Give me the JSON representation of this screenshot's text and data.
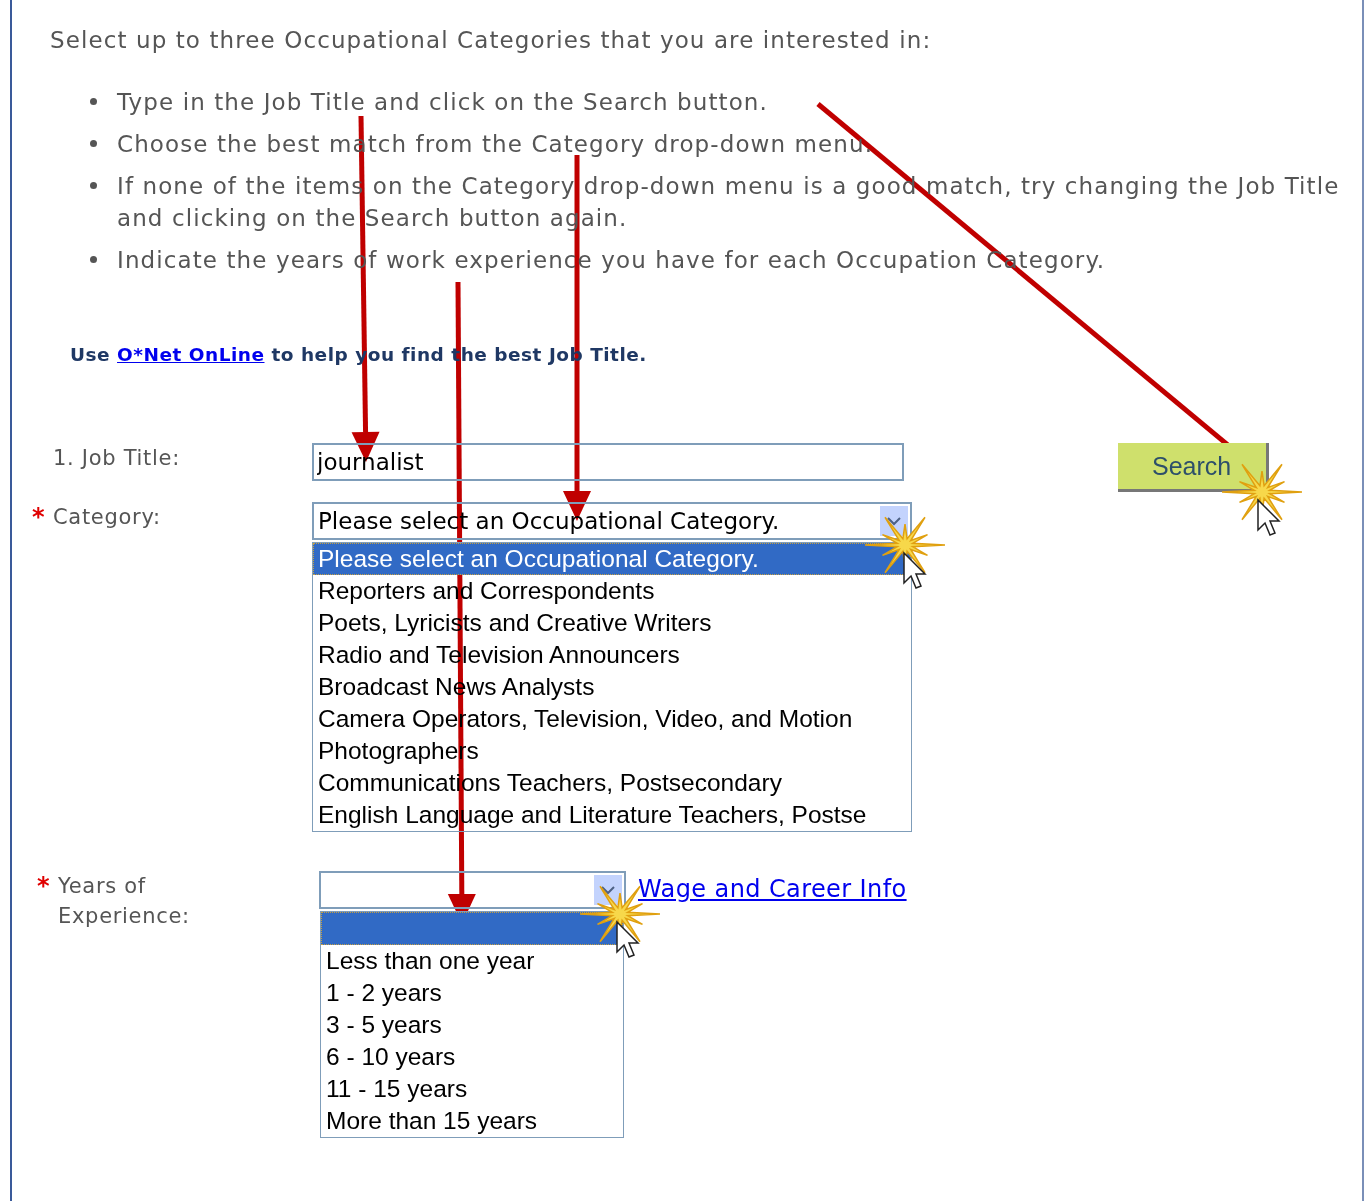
{
  "instructions": {
    "intro": "Select up to three Occupational Categories that you are interested in:",
    "bullets": [
      "Type in the Job Title and click on the Search button.",
      "Choose the best match from the Category drop-down menu.",
      "If none of the items on the Category drop-down menu is a good match, try changing the Job Title and clicking on the Search button again.",
      "Indicate the years of work experience you have for each Occupation Category."
    ]
  },
  "help_note": {
    "before": "Use ",
    "link": "O*Net OnLine",
    "after": " to help you find the best Job Title."
  },
  "form": {
    "job_title": {
      "label": "1. Job Title:",
      "value": "journalist"
    },
    "search_button": "Search",
    "category": {
      "required_mark": "*",
      "label": "Category:",
      "value": "Please select an Occupational Category.",
      "expanded": true,
      "options": [
        {
          "label": "Please select an Occupational Category.",
          "selected": true
        },
        {
          "label": "Reporters and Correspondents",
          "selected": false
        },
        {
          "label": "Poets, Lyricists and Creative Writers",
          "selected": false
        },
        {
          "label": "Radio and Television Announcers",
          "selected": false
        },
        {
          "label": "Broadcast News Analysts",
          "selected": false
        },
        {
          "label": "Camera Operators, Television, Video, and Motion",
          "selected": false
        },
        {
          "label": "Photographers",
          "selected": false
        },
        {
          "label": "Communications Teachers, Postsecondary",
          "selected": false
        },
        {
          "label": "English Language and Literature Teachers, Postse",
          "selected": false
        }
      ]
    },
    "experience": {
      "required_mark": "*",
      "label": "Years of Experience:",
      "expanded": true,
      "link": "Wage and Career Info",
      "options": [
        {
          "selected": true
        },
        {
          "label": "Less than one year",
          "selected": false
        },
        {
          "label": "1 - 2 years",
          "selected": false
        },
        {
          "label": "3 - 5 years",
          "selected": false
        },
        {
          "label": "6 - 10 years",
          "selected": false
        },
        {
          "label": "11 - 15 years",
          "selected": false
        },
        {
          "label": "More than 15 years",
          "selected": false
        }
      ]
    }
  }
}
